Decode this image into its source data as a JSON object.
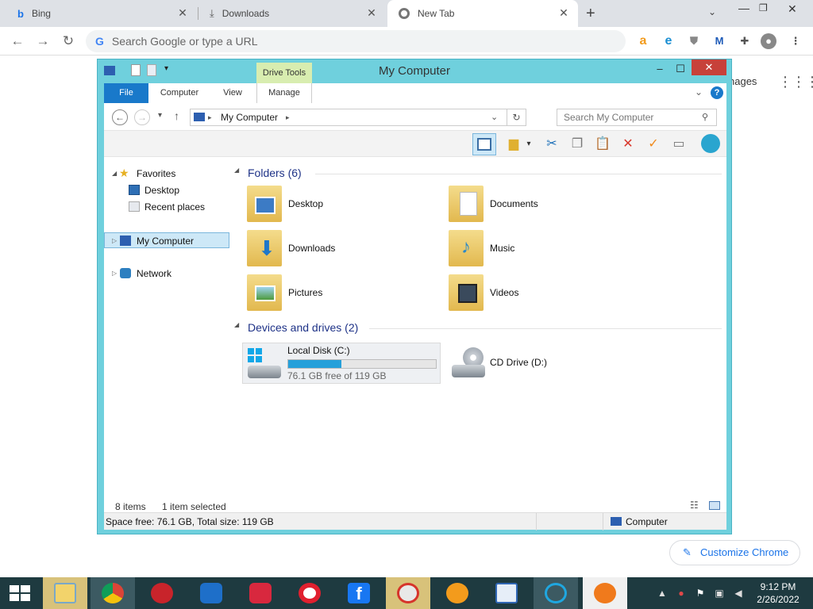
{
  "browser": {
    "tabs": [
      {
        "label": "Bing",
        "icon": "bing-icon"
      },
      {
        "label": "Downloads",
        "icon": "download-icon"
      },
      {
        "label": "New Tab",
        "icon": "chrome-icon",
        "active": true
      }
    ],
    "new_tab": "+",
    "omnibox_placeholder": "Search Google or type a URL",
    "page_fragment": "nages",
    "customize_label": "Customize Chrome"
  },
  "window": {
    "title": "My Computer",
    "contextual_tab_group": "Drive Tools",
    "ribbon_tabs": [
      "File",
      "Computer",
      "View",
      "Manage"
    ],
    "address_path": "My Computer",
    "search_placeholder": "Search My Computer",
    "nav": {
      "favorites": "Favorites",
      "desktop": "Desktop",
      "recent": "Recent places",
      "computer": "My Computer",
      "network": "Network"
    },
    "groups": {
      "folders": "Folders (6)",
      "devices": "Devices and drives (2)"
    },
    "folders": [
      "Desktop",
      "Documents",
      "Downloads",
      "Music",
      "Pictures",
      "Videos"
    ],
    "drives": {
      "local_name": "Local Disk (C:)",
      "local_free": "76.1 GB free of 119 GB",
      "local_used_fraction": 0.36,
      "cd_name": "CD Drive (D:)"
    },
    "status": {
      "items": "8 items",
      "selected": "1 item selected",
      "space": "Space free: 76.1 GB, Total size: 119 GB",
      "location": "Computer"
    }
  },
  "taskbar": {
    "time": "9:12 PM",
    "date": "2/26/2022"
  },
  "colors": {
    "window_frame": "#6fd0dd",
    "file_tab": "#1979ca",
    "drive_tools": "#d8edb0",
    "taskbar": "#1e3a40",
    "progress": "#26a0da"
  }
}
